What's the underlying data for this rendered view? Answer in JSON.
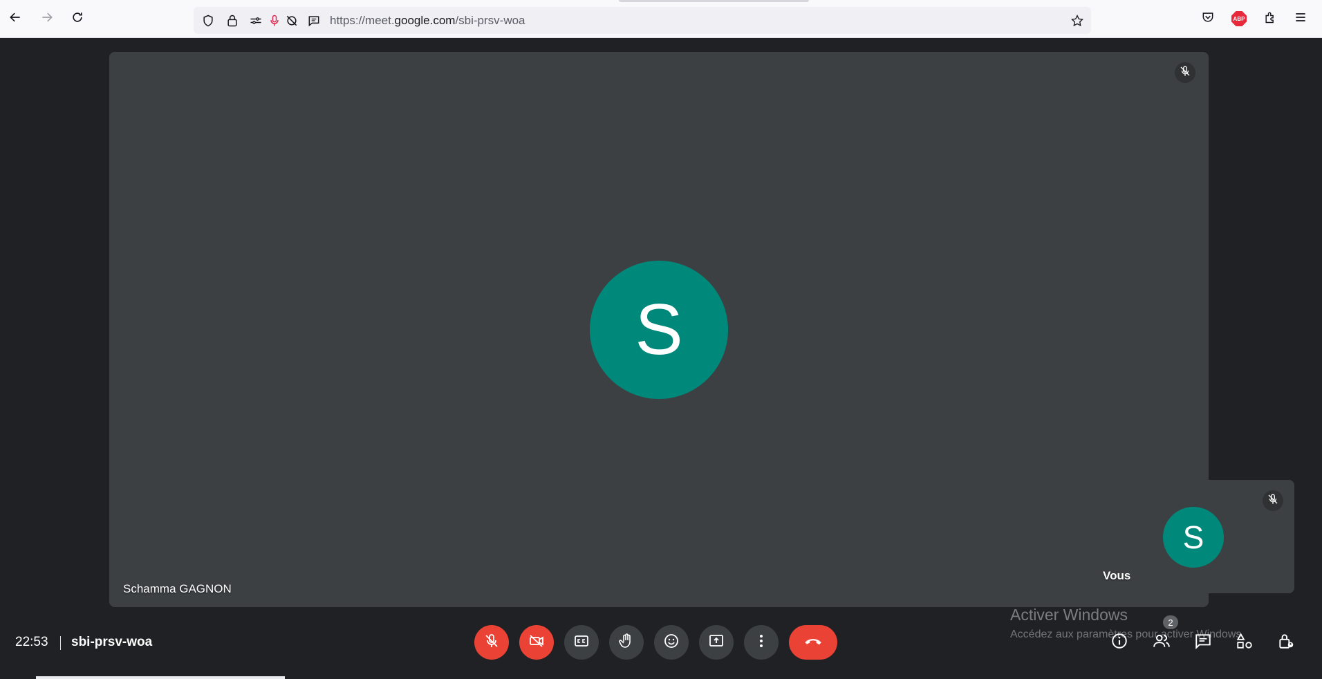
{
  "browser": {
    "url_prefix": "https://meet.",
    "url_host": "google.com",
    "url_path": "/sbi-prsv-woa",
    "icons": [
      "back-arrow-icon",
      "forward-arrow-icon",
      "reload-icon",
      "shield-icon",
      "lock-icon",
      "permissions-icon",
      "microphone-icon",
      "camera-blocked-icon",
      "reader-icon",
      "star-icon",
      "pocket-icon",
      "adblock-plus-icon",
      "extensions-icon",
      "menu-icon"
    ],
    "abp_label": "ABP"
  },
  "meeting": {
    "main_participant": {
      "initial": "S",
      "name": "Schamma GAGNON",
      "muted": true,
      "avatar_color": "#00897b"
    },
    "self_participant": {
      "initial": "S",
      "name": "Vous",
      "muted": true
    },
    "time": "22:53",
    "code": "sbi-prsv-woa",
    "participant_count": "2"
  },
  "controls": {
    "center": [
      "mic-off",
      "camera-off",
      "captions",
      "raise-hand",
      "emoji",
      "present",
      "more-options",
      "leave-call"
    ],
    "right": [
      "meeting-info",
      "people",
      "chat",
      "activities",
      "host-controls"
    ],
    "danger_color": "#ea4335"
  },
  "watermark": {
    "title": "Activer Windows",
    "subtitle": "Accédez aux paramètres pour activer Windows."
  },
  "theme": {
    "background": "#202124",
    "tile": "#3c4043",
    "control": "#3c4043"
  }
}
